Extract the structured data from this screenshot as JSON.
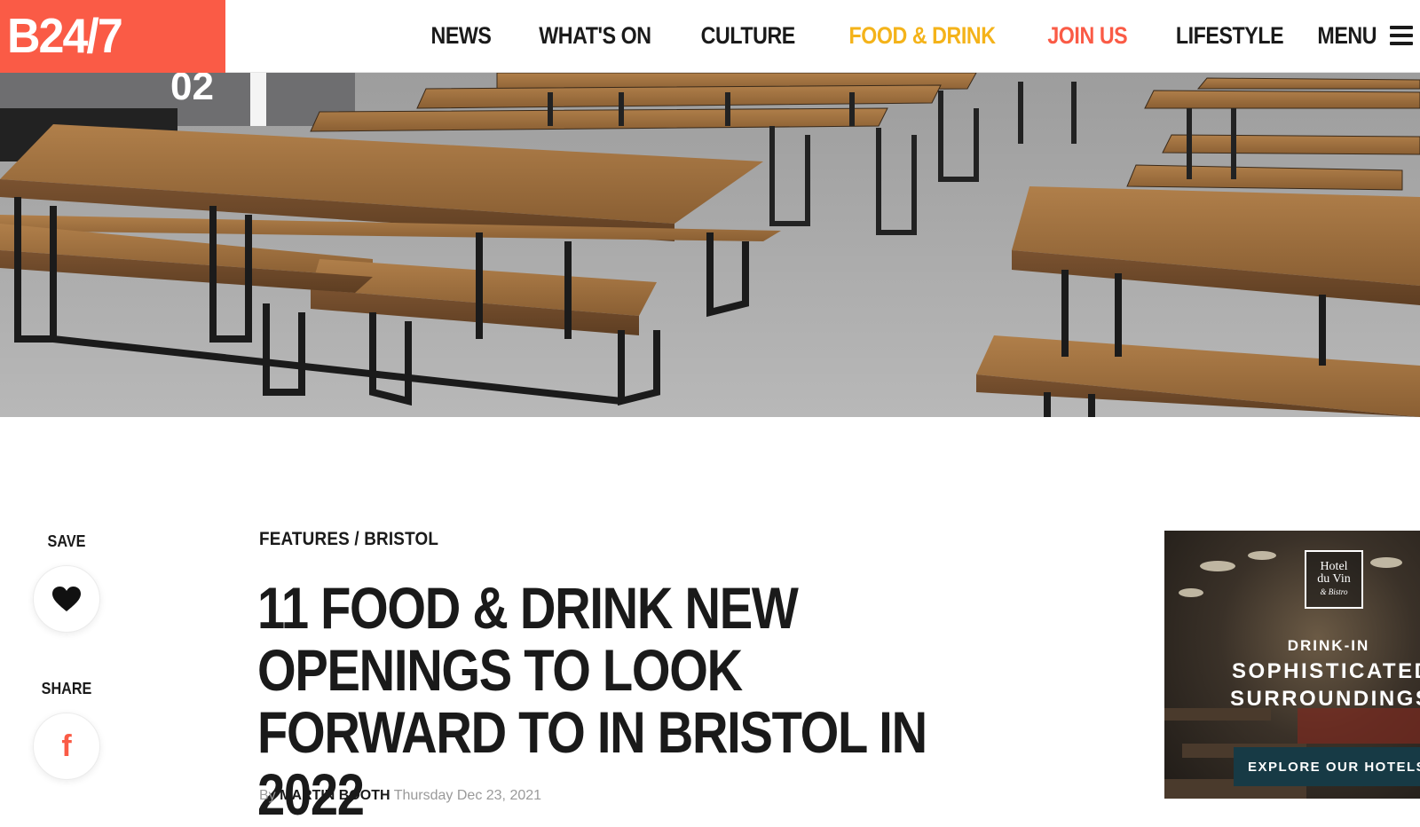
{
  "header": {
    "logo": "B24/7",
    "logo_color": "#fa5b46",
    "nav": [
      {
        "label": "NEWS"
      },
      {
        "label": "WHAT'S ON"
      },
      {
        "label": "CULTURE"
      },
      {
        "label": "FOOD & DRINK",
        "color": "#f4b31a"
      },
      {
        "label": "JOIN US",
        "color": "#fa5b46"
      },
      {
        "label": "LIFESTYLE"
      }
    ],
    "menu_label": "MENU",
    "menu_icon": "hamburger-icon"
  },
  "hero": {
    "sign_text": "02",
    "description_icon": "photo-render"
  },
  "rail": {
    "save_label": "SAVE",
    "save_icon": "heart-icon",
    "share_label": "SHARE",
    "share_icon": "facebook-icon",
    "facebook_glyph": "f"
  },
  "article": {
    "category": "FEATURES",
    "separator": "/",
    "location": "BRISTOL",
    "title": "11 FOOD & DRINK NEW OPENINGS TO LOOK FORWARD TO IN BRISTOL IN 2022",
    "by_prefix": "By",
    "author": "MARTIN BOOTH",
    "date": "Thursday Dec 23, 2021"
  },
  "ad": {
    "hotel_name_1": "Hotel",
    "hotel_name_2": "du Vin",
    "hotel_name_3": "& Bistro",
    "line1": "DRINK-IN",
    "line2": "SOPHISTICATED",
    "line3": "SURROUNDINGS",
    "cta": "EXPLORE OUR HOTELS"
  }
}
